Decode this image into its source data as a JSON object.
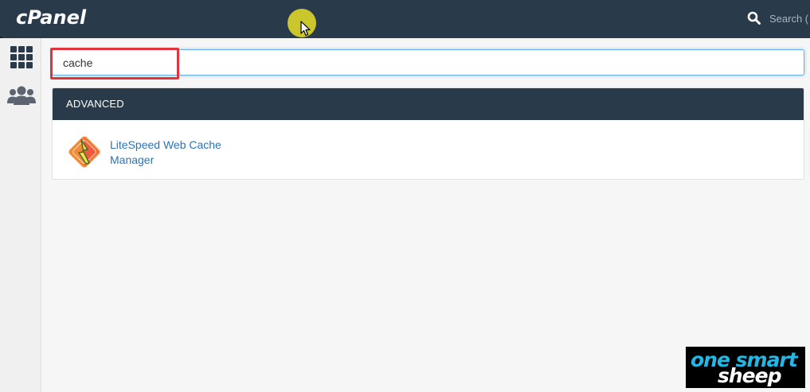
{
  "header": {
    "logo_text": "cPanel",
    "search_placeholder": "Search ( /"
  },
  "sidebar": {
    "items": [
      {
        "icon": "grid-icon"
      },
      {
        "icon": "users-icon"
      }
    ]
  },
  "main": {
    "search_value": "cache",
    "group": {
      "title": "ADVANCED",
      "items": [
        {
          "label": "LiteSpeed Web Cache Manager",
          "icon": "litespeed-icon"
        }
      ]
    }
  },
  "watermark": {
    "line1": "one smart",
    "line2": "sheep"
  },
  "colors": {
    "header_bg": "#293a4a",
    "link": "#2a74b6",
    "highlight_box": "#e0333b",
    "cursor_highlight": "#dcd628",
    "brand_blue": "#22b8e6"
  }
}
